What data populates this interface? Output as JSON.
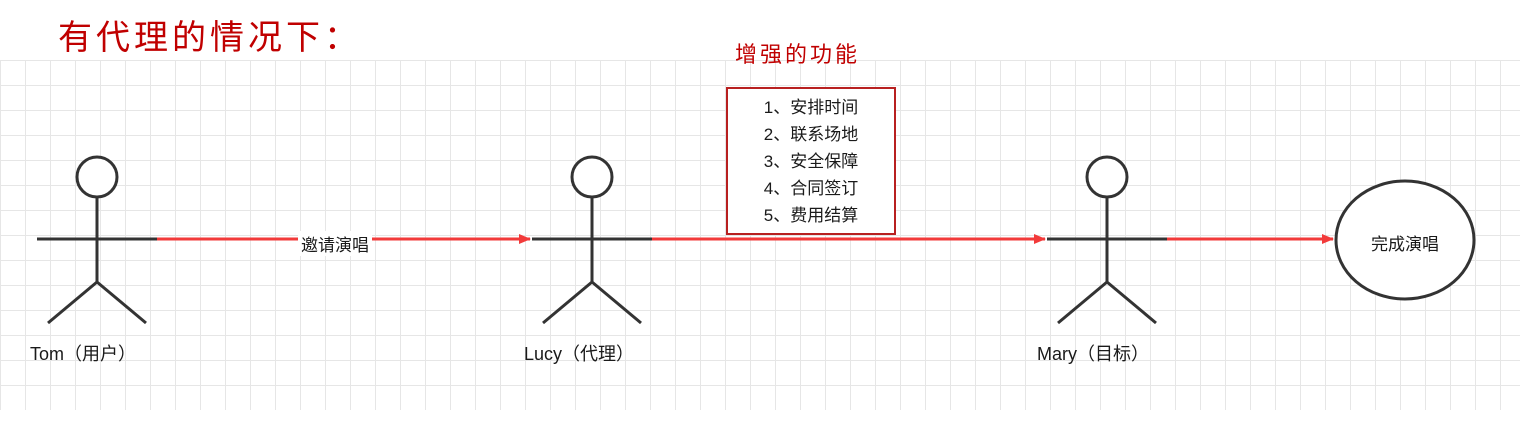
{
  "heading": "有代理的情况下：",
  "enhancement": {
    "title": "增强的功能",
    "items": [
      "1、安排时间",
      "2、联系场地",
      "3、安全保障",
      "4、合同签订",
      "5、费用结算"
    ]
  },
  "actors": [
    {
      "label": "Tom（用户）"
    },
    {
      "label": "Lucy（代理）"
    },
    {
      "label": "Mary（目标）"
    }
  ],
  "edges": [
    {
      "label": "邀请演唱"
    }
  ],
  "end_node": {
    "label": "完成演唱"
  },
  "colors": {
    "heading": "#c00000",
    "arrow": "#f23a3a",
    "box_border": "#b82020",
    "stroke": "#333333",
    "grid": "#e6e6e6"
  }
}
